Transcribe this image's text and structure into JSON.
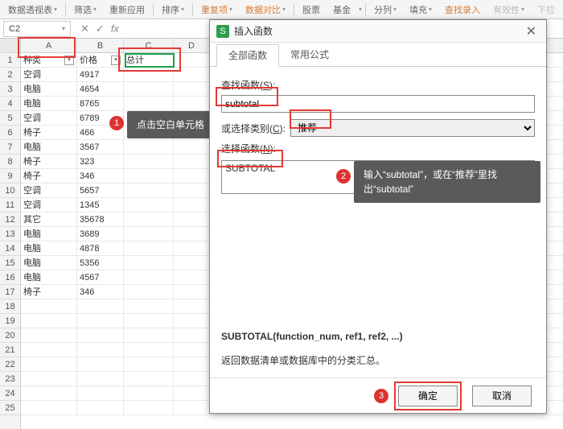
{
  "ribbon": {
    "pivot": "数据透视表",
    "filter": "筛选",
    "reapply": "重新应用",
    "sort": "排序",
    "dedup": "重复项",
    "compare": "数据对比",
    "stock": "股票",
    "fund": "基金",
    "splitcol": "分列",
    "fill": "填充",
    "findentry": "查找录入",
    "validity": "有效性",
    "dropdown": "下拉"
  },
  "namebox": {
    "value": "C2"
  },
  "columns": [
    "A",
    "B",
    "C",
    "D"
  ],
  "headers": {
    "a": "种类",
    "b": "价格",
    "c": "总计"
  },
  "rows": [
    {
      "a": "空调",
      "b": "4917"
    },
    {
      "a": "电脑",
      "b": "4654"
    },
    {
      "a": "电脑",
      "b": "8765"
    },
    {
      "a": "空调",
      "b": "6789"
    },
    {
      "a": "椅子",
      "b": "466"
    },
    {
      "a": "电脑",
      "b": "3567"
    },
    {
      "a": "椅子",
      "b": "323"
    },
    {
      "a": "椅子",
      "b": "346"
    },
    {
      "a": "空调",
      "b": "5657"
    },
    {
      "a": "空调",
      "b": "1345"
    },
    {
      "a": "其它",
      "b": "35678"
    },
    {
      "a": "电脑",
      "b": "3689"
    },
    {
      "a": "电脑",
      "b": "4878"
    },
    {
      "a": "电脑",
      "b": "5356"
    },
    {
      "a": "电脑",
      "b": "4567"
    },
    {
      "a": "椅子",
      "b": "346"
    }
  ],
  "callouts": {
    "c1": "点击空白单元格",
    "c2": "输入“subtotal”，或在“推荐”里找出“subtotal”"
  },
  "dialog": {
    "title": "插入函数",
    "tab1": "全部函数",
    "tab2": "常用公式",
    "searchLabelPrefix": "查找函数(",
    "searchKey": "S",
    "searchLabelSuffix": "):",
    "searchValue": "subtotal",
    "catLabelPrefix": "或选择类别(",
    "catKey": "C",
    "catLabelSuffix": "):",
    "catValue": "推荐",
    "fnLabelPrefix": "选择函数(",
    "fnKey": "N",
    "fnLabelSuffix": "):",
    "fnSelected": "SUBTOTAL",
    "syntax": "SUBTOTAL(function_num, ref1, ref2, ...)",
    "desc": "返回数据清单或数据库中的分类汇总。",
    "ok": "确定",
    "cancel": "取消"
  },
  "icons": {
    "x": "✕",
    "check": "✓",
    "fx": "fx",
    "dd": "▾"
  }
}
